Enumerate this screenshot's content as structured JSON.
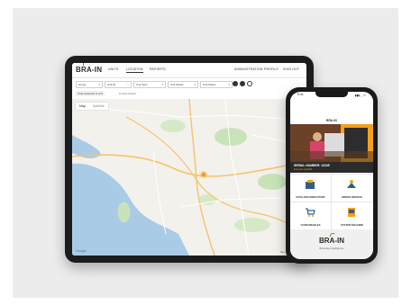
{
  "brand": {
    "name": "BRA-IN",
    "tagline": "Bramidan Intelligence"
  },
  "tablet": {
    "nav": {
      "left": [
        "UNITS",
        "LOCATION",
        "REPORTS"
      ],
      "right": [
        "ADMINISTRATION",
        "PROFILE",
        "SIGN OUT"
      ],
      "active": "LOCATION"
    },
    "filters": {
      "group": "Group",
      "unit_id": "Unit ID",
      "unit_type": "Unit Type",
      "unit_model": "Unit Model",
      "unit_status": "Unit Status"
    },
    "subbar": {
      "selected": "Units selected: 0 of 0",
      "shown": "0 Units shown"
    },
    "map": {
      "tabs": [
        "Map",
        "Satellite"
      ],
      "active_tab": "Map",
      "footer": "Map data ©2024 Google",
      "google": "Google",
      "colors": {
        "land": "#f3f1ec",
        "water": "#a9cbe6",
        "green": "#c9e3b9",
        "road": "#f5c46a",
        "marker": "#f39a1e"
      }
    }
  },
  "phone": {
    "time": "9:41",
    "status": "▮▮▮ ◡ ▭",
    "header_logo": "BRA-IN",
    "serial": "SERIAL NUMBER: 12345",
    "serial_sub": "Free text possible",
    "tiles": [
      {
        "label": "DATA AND DIRECTIONS",
        "icon": "data-icon"
      },
      {
        "label": "ORDER SERVICE",
        "icon": "service-icon"
      },
      {
        "label": "CONSUMABLES",
        "icon": "cart-icon"
      },
      {
        "label": "SYSTEM MACHINE",
        "icon": "machine-icon"
      }
    ],
    "colors": {
      "accent": "#f2a01e",
      "dark": "#2b2b2b"
    }
  }
}
